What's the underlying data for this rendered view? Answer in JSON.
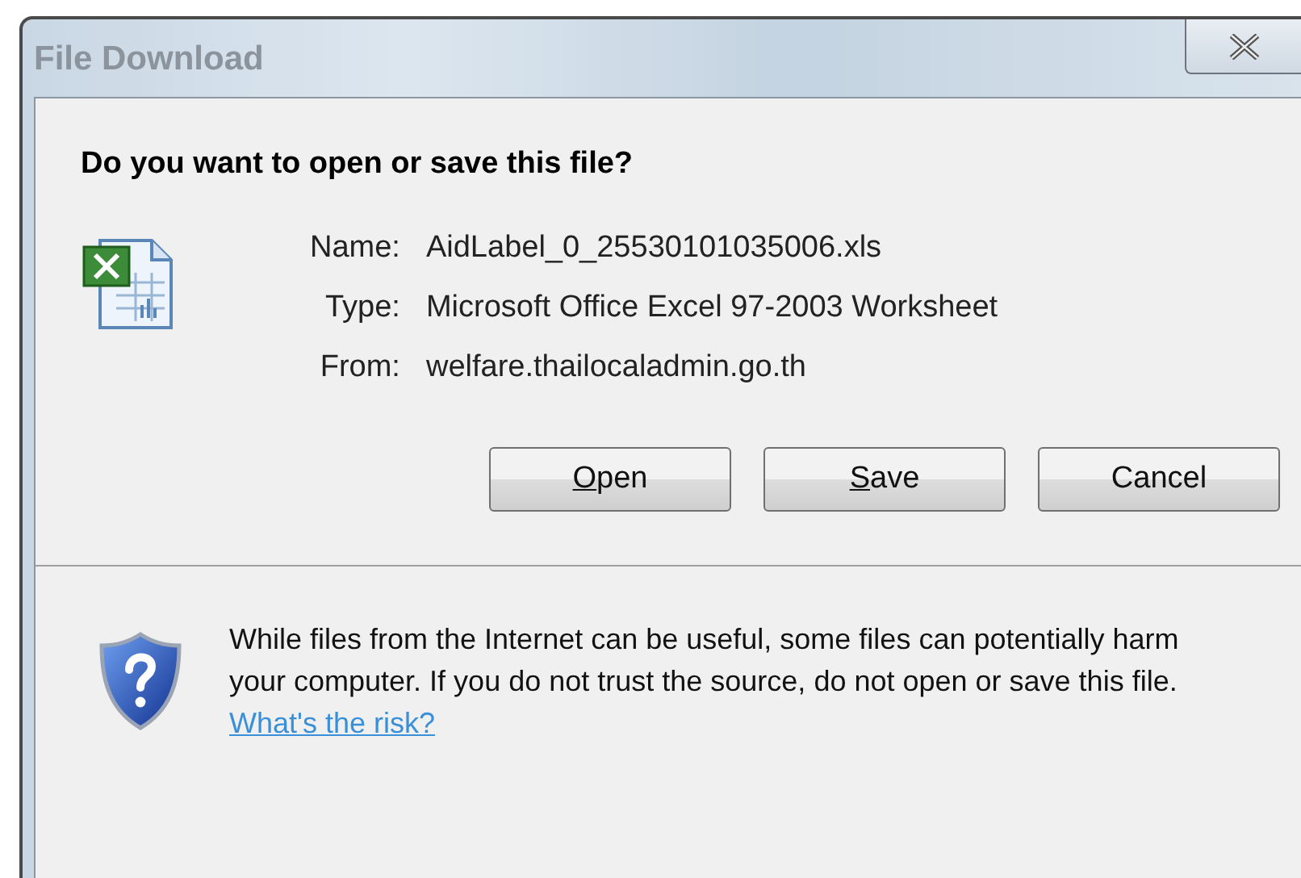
{
  "window": {
    "title": "File Download"
  },
  "question": "Do you want to open or save this file?",
  "details": [
    {
      "label": "Name:",
      "value": "AidLabel_0_25530101035006.xls"
    },
    {
      "label": "Type:",
      "value": "Microsoft Office Excel 97-2003 Worksheet"
    },
    {
      "label": "From:",
      "value": "welfare.thailocaladmin.go.th"
    }
  ],
  "buttons": [
    {
      "label": "Open",
      "underline_first": true
    },
    {
      "label": "Save",
      "underline_first": true
    },
    {
      "label": "Cancel",
      "underline_first": false
    }
  ],
  "warning": {
    "text": "While files from the Internet can be useful, some files can potentially harm your computer. If you do not trust the source, do not open or save this file.",
    "link": "What's the risk?"
  }
}
